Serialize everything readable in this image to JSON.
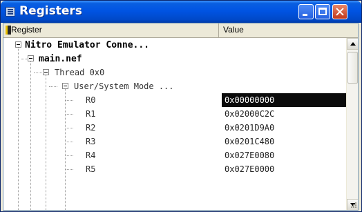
{
  "window": {
    "title": "Registers"
  },
  "columns": {
    "register": "Register",
    "value": "Value"
  },
  "tree": [
    {
      "label": "Nitro Emulator Conne...",
      "value": "",
      "style": "bold"
    },
    {
      "label": "main.nef",
      "value": "",
      "style": "bold"
    },
    {
      "label": "Thread 0x0",
      "value": "",
      "style": "normal"
    },
    {
      "label": "User/System Mode ...",
      "value": "",
      "style": "normal"
    },
    {
      "label": "R0",
      "value": "0x00000000",
      "style": "normal",
      "selected": true
    },
    {
      "label": "R1",
      "value": "0x02000C2C",
      "style": "normal"
    },
    {
      "label": "R2",
      "value": "0x0201D9A0",
      "style": "normal"
    },
    {
      "label": "R3",
      "value": "0x0201C480",
      "style": "normal"
    },
    {
      "label": "R4",
      "value": "0x027E0080",
      "style": "normal"
    },
    {
      "label": "R5",
      "value": "0x027E0000",
      "style": "normal"
    }
  ],
  "icons": {
    "app": "registers-window-icon",
    "header": "register-column-icon"
  }
}
